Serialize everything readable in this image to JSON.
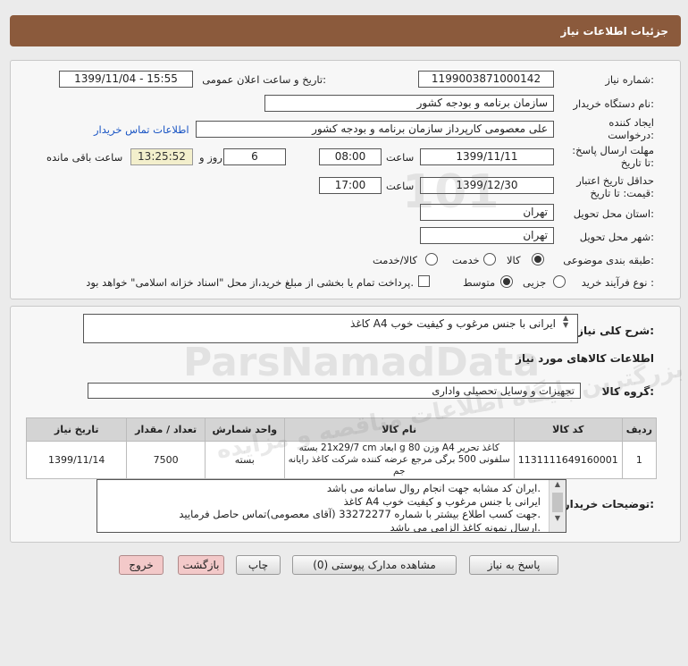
{
  "header": {
    "title": "جزئیات اطلاعات نیاز"
  },
  "form": {
    "need_number_label": "شماره نیاز:",
    "need_number": "1199003871000142",
    "announce_label": "تاریخ و ساعت اعلان عمومی:",
    "announce_value": "1399/11/04 - 15:55",
    "buyer_org_label": "نام دستگاه خریدار:",
    "buyer_org": "سازمان برنامه و بودجه کشور",
    "creator_label": "ایجاد کننده درخواست:",
    "creator": "علی معصومی کارپرداز سازمان برنامه و بودجه کشور",
    "contact_link": "اطلاعات تماس خریدار",
    "deadline_label": "مهلت ارسال پاسخ: تا تاریخ:",
    "deadline_date": "1399/11/11",
    "time_label": "ساعت",
    "deadline_time": "08:00",
    "days": "6",
    "days_and": "روز و",
    "countdown": "13:25:52",
    "remaining_label": "ساعت باقی مانده",
    "validity_label": "حداقل تاریخ اعتبار قیمت: تا تاریخ:",
    "validity_date": "1399/12/30",
    "validity_time": "17:00",
    "province_label": "استان محل تحویل:",
    "province": "تهران",
    "city_label": "شهر محل تحویل:",
    "city": "تهران",
    "category_label": "طبقه بندی موضوعی:",
    "category_options": [
      "کالا",
      "خدمت",
      "کالا/خدمت"
    ],
    "category_selected": "کالا",
    "process_label": "نوع فرآیند خرید :",
    "process_options": [
      "جزیی",
      "متوسط"
    ],
    "process_selected": "متوسط",
    "payment_note": "پرداخت تمام یا بخشی از مبلغ خرید،از محل \"اسناد خزانه اسلامی\" خواهد بود."
  },
  "details": {
    "summary_label": "شرح کلی نیاز:",
    "summary": "کاغذ A4 ایرانی با جنس مرغوب و کیفیت خوب",
    "goods_info_title": "اطلاعات کالاهای مورد نیاز",
    "group_label": "گروه کالا:",
    "group_value": "تجهیزات و وسایل تحصیلی واداری",
    "table": {
      "headers": [
        "ردیف",
        "کد کالا",
        "نام کالا",
        "واحد شمارش",
        "تعداد / مقدار",
        "تاریخ نیاز"
      ],
      "rows": [
        {
          "row": "1",
          "code": "1131111649160001",
          "name": "کاغذ تحریر A4 وزن 80 g ابعاد 21x29/7 cm بسته سلفونی 500 برگی مرجع عرضه کننده شرکت کاغذ رایانه جم",
          "unit": "بسته",
          "qty": "7500",
          "date": "1399/11/14"
        }
      ]
    },
    "buyer_notes_label": "توضیحات خریدار:",
    "buyer_notes": [
      "ایران کد مشابه جهت انجام روال سامانه می باشد.",
      "کاغذ A4 ایرانی با جنس مرغوب و کیفیت خوب",
      "جهت کسب اطلاع بیشتر با شماره 33272277 (آقای معصومی)تماس حاصل فرمایید.",
      "ارسال نمونه کاغذ الزامی می باشد."
    ]
  },
  "buttons": {
    "reply": "پاسخ به نیاز",
    "attachments": "مشاهده مدارک پیوستی (0)",
    "print": "چاپ",
    "back": "بازگشت",
    "exit": "خروج"
  },
  "watermark": {
    "brand": "ParsNamadData",
    "tagline": "بزرگترین پایگاه اطلاعات مناقصه و مزایده",
    "number": "101"
  }
}
